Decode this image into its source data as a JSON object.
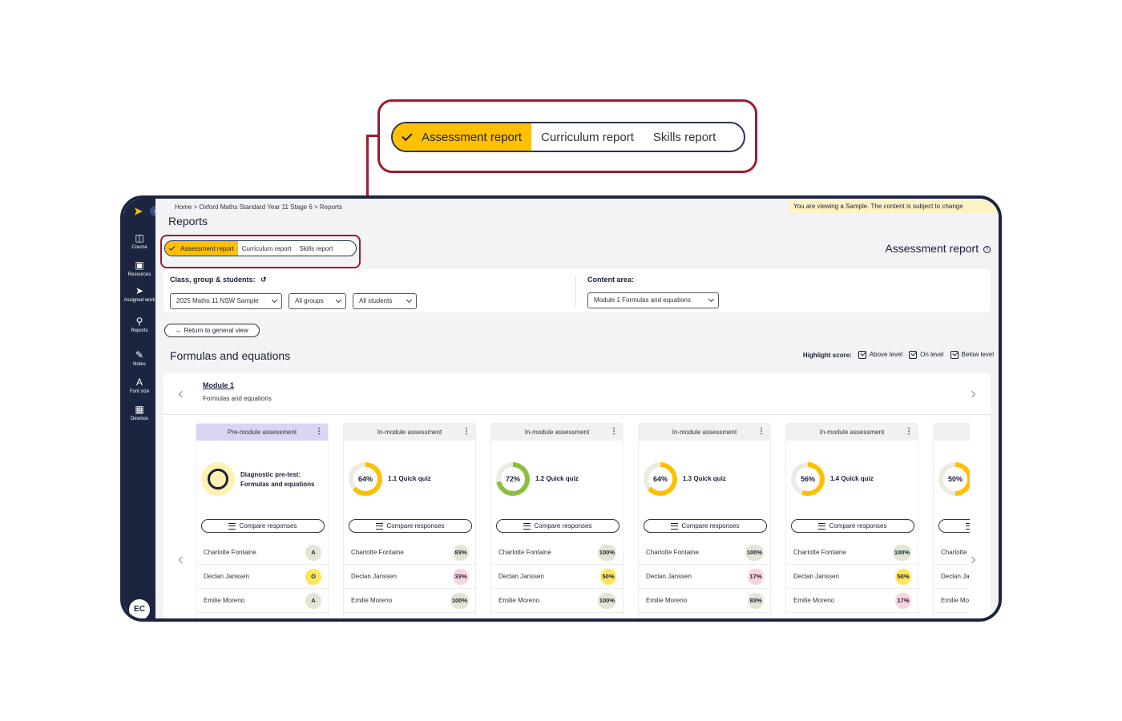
{
  "zoom_callout": {
    "tabs": [
      {
        "label": "Assessment report",
        "active": true
      },
      {
        "label": "Curriculum report",
        "active": false
      },
      {
        "label": "Skills report",
        "active": false
      }
    ]
  },
  "sidebar": {
    "items": [
      {
        "label": "Course",
        "icon": "book-icon"
      },
      {
        "label": "Resources",
        "icon": "folder-icon"
      },
      {
        "label": "Assigned work",
        "icon": "send-icon"
      },
      {
        "label": "Reports",
        "icon": "reports-icon"
      },
      {
        "label": "Notes",
        "icon": "pencil-icon"
      },
      {
        "label": "Font size",
        "icon": "font-size-icon"
      },
      {
        "label": "Desmos",
        "icon": "desmos-icon"
      }
    ],
    "avatar": "EC"
  },
  "header": {
    "breadcrumb": [
      "Home",
      "Oxford Maths Standard Year 11 Stage 6",
      "Reports"
    ],
    "title": "Reports",
    "sample_banner": "You are viewing a Sample. The content is subject to change"
  },
  "tabs": [
    {
      "label": "Assessment report",
      "active": true
    },
    {
      "label": "Curriculum report",
      "active": false
    },
    {
      "label": "Skills report",
      "active": false
    }
  ],
  "report_heading": "Assessment report",
  "filters": {
    "class_label": "Class, group & students:",
    "class_value": "2025 Maths 11 NSW Sample",
    "groups_value": "All groups",
    "students_value": "All students",
    "content_label": "Content area:",
    "content_value": "Module 1 Formulas and equations"
  },
  "return_button": "Return to general view",
  "section_title": "Formulas and equations",
  "highlight": {
    "label": "Highlight score:",
    "options": [
      "Above level",
      "On level",
      "Below level"
    ]
  },
  "module": {
    "name": "Module 1",
    "subtitle": "Formulas and equations"
  },
  "compare_label": "Compare responses",
  "colors": {
    "accent": "#ffc000",
    "sidebar": "#1c2540",
    "callout": "#9b1c2e",
    "ring_green": "#8cbf3f"
  },
  "cards": [
    {
      "type": "Pre-module assessment",
      "title": "Diagnostic pre-test: Formulas and equations",
      "score": "O",
      "percent": null,
      "rows": [
        {
          "name": "Charlotte Fontaine",
          "score": "A",
          "level": "green"
        },
        {
          "name": "Declan Janssen",
          "score": "O",
          "level": "yellow"
        },
        {
          "name": "Emilie Moreno",
          "score": "A",
          "level": "green"
        }
      ]
    },
    {
      "type": "In-module assessment",
      "title": "1.1 Quick quiz",
      "score": "64%",
      "percent": 64,
      "ring": "#ffc000",
      "rows": [
        {
          "name": "Charlotte Fontaine",
          "score": "83%",
          "level": "green"
        },
        {
          "name": "Declan Janssen",
          "score": "33%",
          "level": "pink"
        },
        {
          "name": "Emilie Moreno",
          "score": "100%",
          "level": "green"
        }
      ]
    },
    {
      "type": "In-module assessment",
      "title": "1.2 Quick quiz",
      "score": "72%",
      "percent": 72,
      "ring": "#8cbf3f",
      "rows": [
        {
          "name": "Charlotte Fontaine",
          "score": "100%",
          "level": "green"
        },
        {
          "name": "Declan Janssen",
          "score": "50%",
          "level": "yellow"
        },
        {
          "name": "Emilie Moreno",
          "score": "100%",
          "level": "green"
        }
      ]
    },
    {
      "type": "In-module assessment",
      "title": "1.3 Quick quiz",
      "score": "64%",
      "percent": 64,
      "ring": "#ffc000",
      "rows": [
        {
          "name": "Charlotte Fontaine",
          "score": "100%",
          "level": "green"
        },
        {
          "name": "Declan Janssen",
          "score": "17%",
          "level": "pink"
        },
        {
          "name": "Emilie Moreno",
          "score": "83%",
          "level": "green"
        }
      ]
    },
    {
      "type": "In-module assessment",
      "title": "1.4 Quick quiz",
      "score": "56%",
      "percent": 56,
      "ring": "#ffc000",
      "rows": [
        {
          "name": "Charlotte Fontaine",
          "score": "100%",
          "level": "green"
        },
        {
          "name": "Declan Janssen",
          "score": "50%",
          "level": "yellow"
        },
        {
          "name": "Emilie Moreno",
          "score": "17%",
          "level": "pink"
        }
      ]
    },
    {
      "type": "In-",
      "title": "",
      "score": "50%",
      "percent": 50,
      "ring": "#ffc000",
      "rows": [
        {
          "name": "Charlotte",
          "score": "",
          "level": ""
        },
        {
          "name": "Declan Ja",
          "score": "",
          "level": ""
        },
        {
          "name": "Emilie Mo",
          "score": "",
          "level": ""
        }
      ]
    }
  ]
}
